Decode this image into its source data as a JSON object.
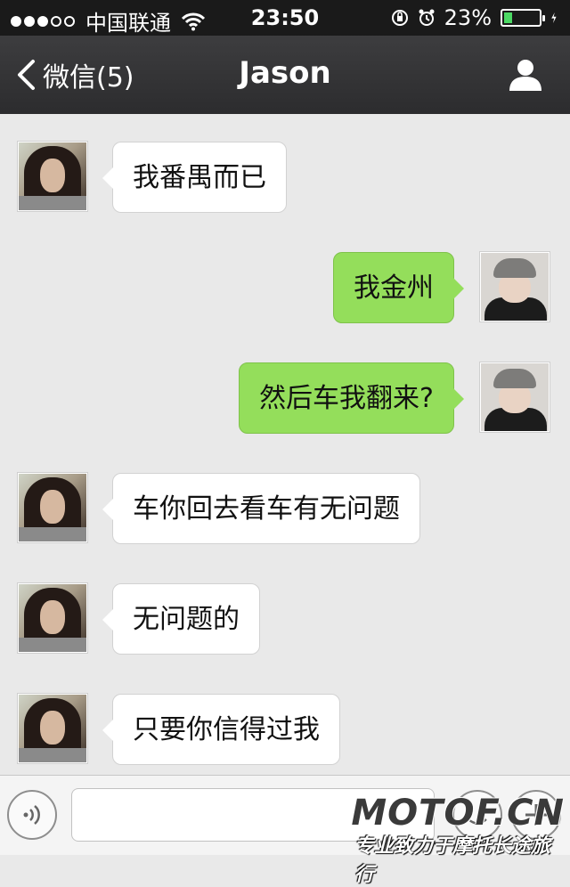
{
  "status_bar": {
    "carrier": "中国联通",
    "time": "23:50",
    "battery_percent": "23%",
    "battery_level": 0.23,
    "signal_dots_filled": 3,
    "signal_dots_total": 5
  },
  "nav": {
    "back_label": "微信(5)",
    "title": "Jason"
  },
  "messages": [
    {
      "direction": "in",
      "text": "我番禺而已"
    },
    {
      "direction": "out",
      "text": "我金州"
    },
    {
      "direction": "out",
      "text": "然后车我翻来?"
    },
    {
      "direction": "in",
      "text": "车你回去看车有无问题"
    },
    {
      "direction": "in",
      "text": "无问题的"
    },
    {
      "direction": "in",
      "text": "只要你信得过我"
    }
  ],
  "input_bar": {
    "voice_icon": "voice-icon",
    "emoji_icon": "emoji-icon",
    "plus_icon": "plus-icon"
  },
  "watermark": {
    "logo": "MOTOF.CN",
    "slogan": "专业致力于摩托长途旅行"
  },
  "colors": {
    "nav_bg": "#333335",
    "chat_bg": "#e9e9e9",
    "outgoing_bubble": "#94de5b",
    "incoming_bubble": "#ffffff",
    "battery_fill": "#4cd964"
  }
}
